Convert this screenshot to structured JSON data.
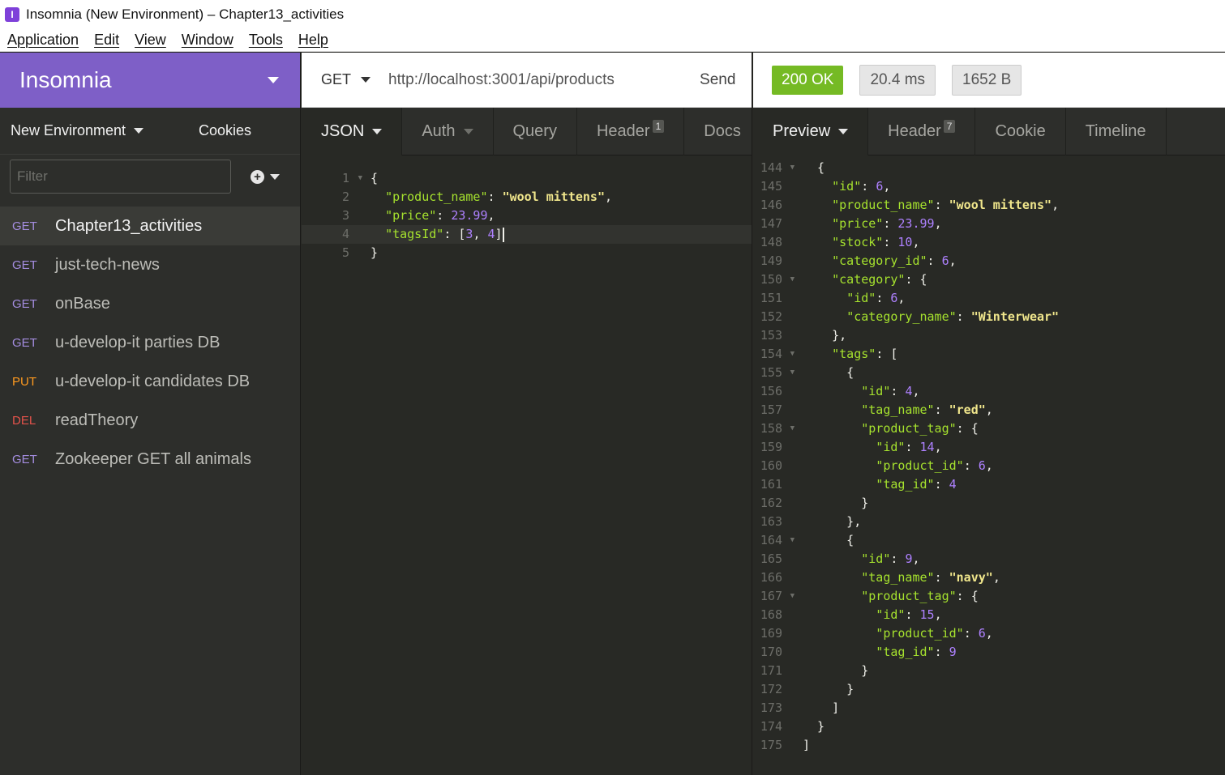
{
  "window": {
    "icon_glyph": "I",
    "title": "Insomnia (New Environment) – Chapter13_activities"
  },
  "menu": [
    "Application",
    "Edit",
    "View",
    "Window",
    "Tools",
    "Help"
  ],
  "sidebar": {
    "workspace": "Insomnia",
    "environment": "New Environment",
    "cookies": "Cookies",
    "filter_placeholder": "Filter",
    "add_glyph": "+",
    "requests": [
      {
        "method": "GET",
        "name": "Chapter13_activities",
        "color": "#a48de0",
        "active": true
      },
      {
        "method": "GET",
        "name": "just-tech-news",
        "color": "#a48de0"
      },
      {
        "method": "GET",
        "name": "onBase",
        "color": "#a48de0"
      },
      {
        "method": "GET",
        "name": "u-develop-it parties DB",
        "color": "#a48de0"
      },
      {
        "method": "PUT",
        "name": "u-develop-it candidates DB",
        "color": "#ff9a1f"
      },
      {
        "method": "DEL",
        "name": "readTheory",
        "color": "#e5534b"
      },
      {
        "method": "GET",
        "name": "Zookeeper GET all animals",
        "color": "#a48de0"
      }
    ]
  },
  "request": {
    "method": "GET",
    "url": "http://localhost:3001/api/products",
    "send_label": "Send",
    "tabs": {
      "body": "JSON",
      "auth": "Auth",
      "query": "Query",
      "header": "Header",
      "header_count": "1",
      "docs": "Docs"
    },
    "body_lines": [
      {
        "n": "1",
        "fold": true,
        "tokens": [
          {
            "t": "{",
            "c": "p"
          }
        ]
      },
      {
        "n": "2",
        "tokens": [
          {
            "t": "  ",
            "c": "p"
          },
          {
            "t": "\"product_name\"",
            "c": "k"
          },
          {
            "t": ": ",
            "c": "p"
          },
          {
            "t": "\"wool mittens\"",
            "c": "s-b"
          },
          {
            "t": ",",
            "c": "p"
          }
        ]
      },
      {
        "n": "3",
        "tokens": [
          {
            "t": "  ",
            "c": "p"
          },
          {
            "t": "\"price\"",
            "c": "k"
          },
          {
            "t": ": ",
            "c": "p"
          },
          {
            "t": "23.99",
            "c": "n"
          },
          {
            "t": ",",
            "c": "p"
          }
        ]
      },
      {
        "n": "4",
        "active": true,
        "cursor": true,
        "tokens": [
          {
            "t": "  ",
            "c": "p"
          },
          {
            "t": "\"tagsId\"",
            "c": "k"
          },
          {
            "t": ": [",
            "c": "p"
          },
          {
            "t": "3",
            "c": "n"
          },
          {
            "t": ", ",
            "c": "p"
          },
          {
            "t": "4",
            "c": "n"
          },
          {
            "t": "]",
            "c": "p"
          }
        ]
      },
      {
        "n": "5",
        "tokens": [
          {
            "t": "}",
            "c": "p"
          }
        ]
      }
    ]
  },
  "response": {
    "status": "200 OK",
    "time": "20.4 ms",
    "size": "1652 B",
    "tabs": {
      "preview": "Preview",
      "header": "Header",
      "header_count": "7",
      "cookie": "Cookie",
      "timeline": "Timeline"
    },
    "body_lines": [
      {
        "n": "144",
        "fold": true,
        "tokens": [
          {
            "t": "  {",
            "c": "p"
          }
        ]
      },
      {
        "n": "145",
        "tokens": [
          {
            "t": "    ",
            "c": "p"
          },
          {
            "t": "\"id\"",
            "c": "k"
          },
          {
            "t": ": ",
            "c": "p"
          },
          {
            "t": "6",
            "c": "n"
          },
          {
            "t": ",",
            "c": "p"
          }
        ]
      },
      {
        "n": "146",
        "tokens": [
          {
            "t": "    ",
            "c": "p"
          },
          {
            "t": "\"product_name\"",
            "c": "k"
          },
          {
            "t": ": ",
            "c": "p"
          },
          {
            "t": "\"wool mittens\"",
            "c": "s-b"
          },
          {
            "t": ",",
            "c": "p"
          }
        ]
      },
      {
        "n": "147",
        "tokens": [
          {
            "t": "    ",
            "c": "p"
          },
          {
            "t": "\"price\"",
            "c": "k"
          },
          {
            "t": ": ",
            "c": "p"
          },
          {
            "t": "23.99",
            "c": "n"
          },
          {
            "t": ",",
            "c": "p"
          }
        ]
      },
      {
        "n": "148",
        "tokens": [
          {
            "t": "    ",
            "c": "p"
          },
          {
            "t": "\"stock\"",
            "c": "k"
          },
          {
            "t": ": ",
            "c": "p"
          },
          {
            "t": "10",
            "c": "n"
          },
          {
            "t": ",",
            "c": "p"
          }
        ]
      },
      {
        "n": "149",
        "tokens": [
          {
            "t": "    ",
            "c": "p"
          },
          {
            "t": "\"category_id\"",
            "c": "k"
          },
          {
            "t": ": ",
            "c": "p"
          },
          {
            "t": "6",
            "c": "n"
          },
          {
            "t": ",",
            "c": "p"
          }
        ]
      },
      {
        "n": "150",
        "fold": true,
        "tokens": [
          {
            "t": "    ",
            "c": "p"
          },
          {
            "t": "\"category\"",
            "c": "k"
          },
          {
            "t": ": {",
            "c": "p"
          }
        ]
      },
      {
        "n": "151",
        "tokens": [
          {
            "t": "      ",
            "c": "p"
          },
          {
            "t": "\"id\"",
            "c": "k"
          },
          {
            "t": ": ",
            "c": "p"
          },
          {
            "t": "6",
            "c": "n"
          },
          {
            "t": ",",
            "c": "p"
          }
        ]
      },
      {
        "n": "152",
        "tokens": [
          {
            "t": "      ",
            "c": "p"
          },
          {
            "t": "\"category_name\"",
            "c": "k"
          },
          {
            "t": ": ",
            "c": "p"
          },
          {
            "t": "\"Winterwear\"",
            "c": "s-b"
          }
        ]
      },
      {
        "n": "153",
        "tokens": [
          {
            "t": "    },",
            "c": "p"
          }
        ]
      },
      {
        "n": "154",
        "fold": true,
        "tokens": [
          {
            "t": "    ",
            "c": "p"
          },
          {
            "t": "\"tags\"",
            "c": "k"
          },
          {
            "t": ": [",
            "c": "p"
          }
        ]
      },
      {
        "n": "155",
        "fold": true,
        "tokens": [
          {
            "t": "      {",
            "c": "p"
          }
        ]
      },
      {
        "n": "156",
        "tokens": [
          {
            "t": "        ",
            "c": "p"
          },
          {
            "t": "\"id\"",
            "c": "k"
          },
          {
            "t": ": ",
            "c": "p"
          },
          {
            "t": "4",
            "c": "n"
          },
          {
            "t": ",",
            "c": "p"
          }
        ]
      },
      {
        "n": "157",
        "tokens": [
          {
            "t": "        ",
            "c": "p"
          },
          {
            "t": "\"tag_name\"",
            "c": "k"
          },
          {
            "t": ": ",
            "c": "p"
          },
          {
            "t": "\"red\"",
            "c": "s-b"
          },
          {
            "t": ",",
            "c": "p"
          }
        ]
      },
      {
        "n": "158",
        "fold": true,
        "tokens": [
          {
            "t": "        ",
            "c": "p"
          },
          {
            "t": "\"product_tag\"",
            "c": "k"
          },
          {
            "t": ": {",
            "c": "p"
          }
        ]
      },
      {
        "n": "159",
        "tokens": [
          {
            "t": "          ",
            "c": "p"
          },
          {
            "t": "\"id\"",
            "c": "k"
          },
          {
            "t": ": ",
            "c": "p"
          },
          {
            "t": "14",
            "c": "n"
          },
          {
            "t": ",",
            "c": "p"
          }
        ]
      },
      {
        "n": "160",
        "tokens": [
          {
            "t": "          ",
            "c": "p"
          },
          {
            "t": "\"product_id\"",
            "c": "k"
          },
          {
            "t": ": ",
            "c": "p"
          },
          {
            "t": "6",
            "c": "n"
          },
          {
            "t": ",",
            "c": "p"
          }
        ]
      },
      {
        "n": "161",
        "tokens": [
          {
            "t": "          ",
            "c": "p"
          },
          {
            "t": "\"tag_id\"",
            "c": "k"
          },
          {
            "t": ": ",
            "c": "p"
          },
          {
            "t": "4",
            "c": "n"
          }
        ]
      },
      {
        "n": "162",
        "tokens": [
          {
            "t": "        }",
            "c": "p"
          }
        ]
      },
      {
        "n": "163",
        "tokens": [
          {
            "t": "      },",
            "c": "p"
          }
        ]
      },
      {
        "n": "164",
        "fold": true,
        "tokens": [
          {
            "t": "      {",
            "c": "p"
          }
        ]
      },
      {
        "n": "165",
        "tokens": [
          {
            "t": "        ",
            "c": "p"
          },
          {
            "t": "\"id\"",
            "c": "k"
          },
          {
            "t": ": ",
            "c": "p"
          },
          {
            "t": "9",
            "c": "n"
          },
          {
            "t": ",",
            "c": "p"
          }
        ]
      },
      {
        "n": "166",
        "tokens": [
          {
            "t": "        ",
            "c": "p"
          },
          {
            "t": "\"tag_name\"",
            "c": "k"
          },
          {
            "t": ": ",
            "c": "p"
          },
          {
            "t": "\"navy\"",
            "c": "s-b"
          },
          {
            "t": ",",
            "c": "p"
          }
        ]
      },
      {
        "n": "167",
        "fold": true,
        "tokens": [
          {
            "t": "        ",
            "c": "p"
          },
          {
            "t": "\"product_tag\"",
            "c": "k"
          },
          {
            "t": ": {",
            "c": "p"
          }
        ]
      },
      {
        "n": "168",
        "tokens": [
          {
            "t": "          ",
            "c": "p"
          },
          {
            "t": "\"id\"",
            "c": "k"
          },
          {
            "t": ": ",
            "c": "p"
          },
          {
            "t": "15",
            "c": "n"
          },
          {
            "t": ",",
            "c": "p"
          }
        ]
      },
      {
        "n": "169",
        "tokens": [
          {
            "t": "          ",
            "c": "p"
          },
          {
            "t": "\"product_id\"",
            "c": "k"
          },
          {
            "t": ": ",
            "c": "p"
          },
          {
            "t": "6",
            "c": "n"
          },
          {
            "t": ",",
            "c": "p"
          }
        ]
      },
      {
        "n": "170",
        "tokens": [
          {
            "t": "          ",
            "c": "p"
          },
          {
            "t": "\"tag_id\"",
            "c": "k"
          },
          {
            "t": ": ",
            "c": "p"
          },
          {
            "t": "9",
            "c": "n"
          }
        ]
      },
      {
        "n": "171",
        "tokens": [
          {
            "t": "        }",
            "c": "p"
          }
        ]
      },
      {
        "n": "172",
        "tokens": [
          {
            "t": "      }",
            "c": "p"
          }
        ]
      },
      {
        "n": "173",
        "tokens": [
          {
            "t": "    ]",
            "c": "p"
          }
        ]
      },
      {
        "n": "174",
        "tokens": [
          {
            "t": "  }",
            "c": "p"
          }
        ]
      },
      {
        "n": "175",
        "tokens": [
          {
            "t": "]",
            "c": "p"
          }
        ]
      }
    ]
  },
  "colors": {
    "brand": "#7e5fc7",
    "status_ok": "#75ba24",
    "json_key": "#a6e22e",
    "json_string": "#e6db74",
    "json_number": "#ae81ff"
  }
}
